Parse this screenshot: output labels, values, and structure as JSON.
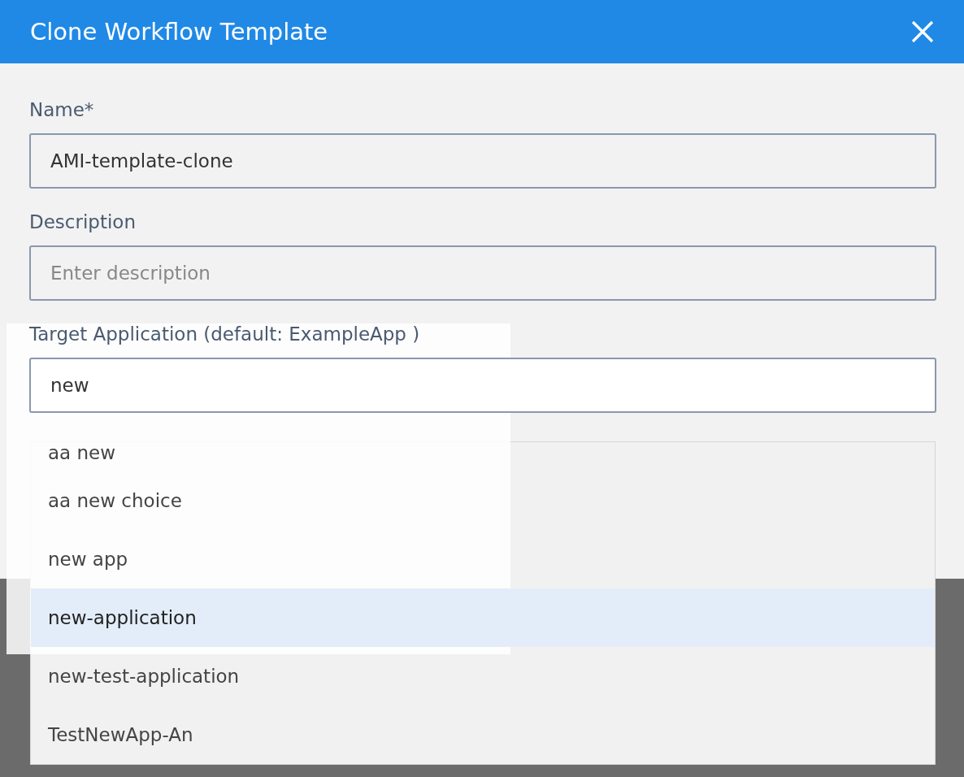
{
  "dialog": {
    "title": "Clone Workflow Template"
  },
  "fields": [
    {
      "label": "Name*",
      "value": "AMI-template-clone"
    },
    {
      "label": "Description",
      "placeholder": "Enter description"
    },
    {
      "label": "Target Application (default: ExampleApp )",
      "value": "new"
    }
  ],
  "dropdown": {
    "options": [
      {
        "label": "aa new",
        "selected": false
      },
      {
        "label": "aa new choice",
        "selected": false
      },
      {
        "label": "new app",
        "selected": false
      },
      {
        "label": "new-application",
        "selected": true
      },
      {
        "label": "new-test-application",
        "selected": false
      },
      {
        "label": "TestNewApp-An",
        "selected": false
      }
    ]
  }
}
